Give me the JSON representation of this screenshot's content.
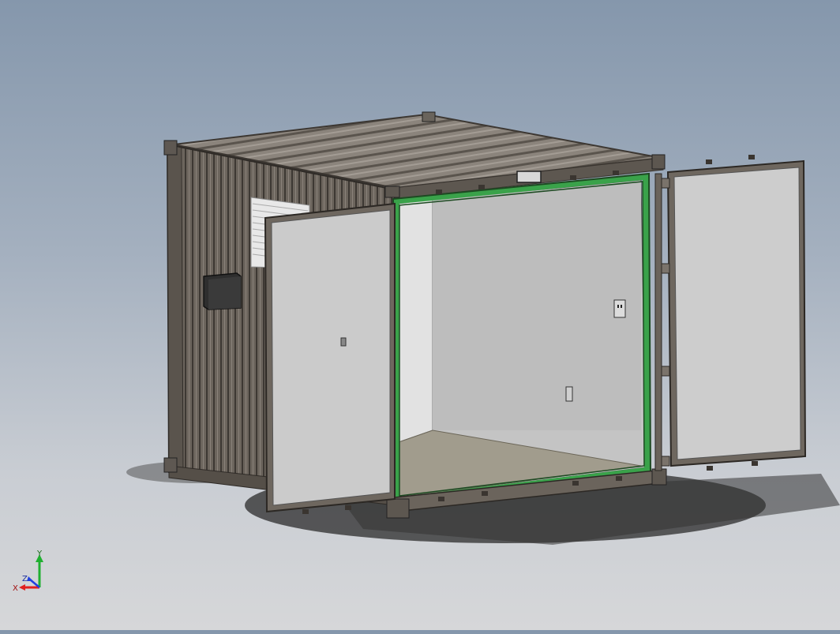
{
  "viewport": {
    "background_top": "#8597ac",
    "background_bottom": "#d6d7d9",
    "model": {
      "kind": "shipping-container",
      "frame_color": "#6f675f",
      "panel_color": "#c8c8c8",
      "floor_color": "#a09b8c",
      "door_seal_color": "#3aa24a",
      "doors": "open"
    }
  },
  "triad": {
    "x_label": "X",
    "y_label": "Y",
    "z_label": "Z",
    "x_color": "#e02020",
    "y_color": "#20b030",
    "z_color": "#2040e0"
  }
}
